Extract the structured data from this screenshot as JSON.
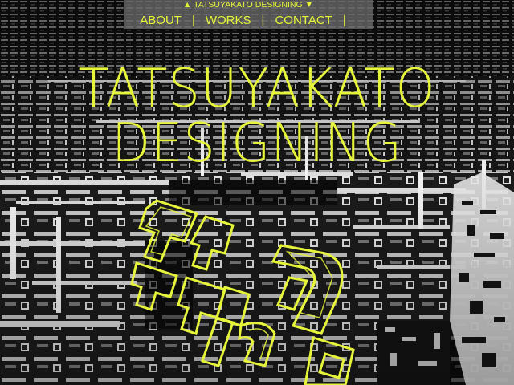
{
  "theme": {
    "accent": "#e6f53a",
    "background": "#0d0d0d",
    "bar_background": "#6a6a6a"
  },
  "header": {
    "site_label": "▲ TATSUYAKATO DESIGNING ▼"
  },
  "nav": {
    "items": [
      {
        "label": "ABOUT",
        "separator": "|"
      },
      {
        "label": "WORKS",
        "separator": "|"
      },
      {
        "label": "CONTACT",
        "separator": "|"
      }
    ]
  },
  "hero": {
    "line1": "TATSUYAKATO",
    "line2": "DESIGNING"
  },
  "icons": {
    "background": "abstract-3d-city-art",
    "logo": "outlined-tkd-logo"
  }
}
